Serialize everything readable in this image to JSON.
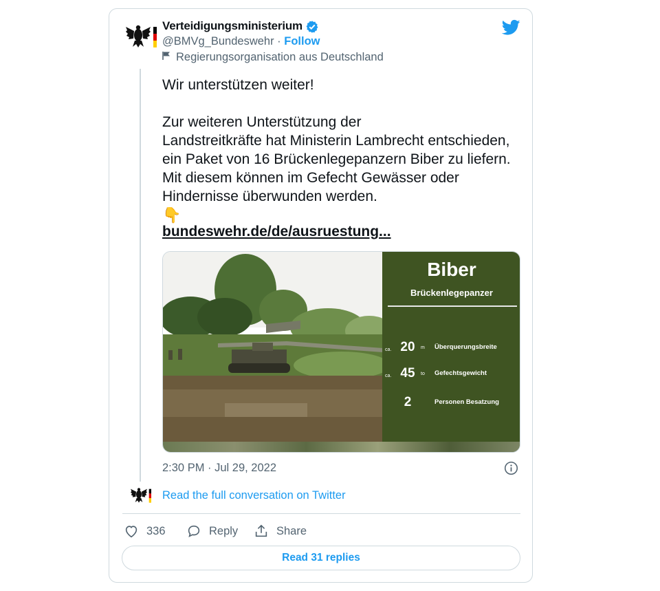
{
  "author": {
    "name": "Verteidigungsministerium",
    "handle": "@BMVg_Bundeswehr",
    "separator": " · ",
    "follow_label": "Follow",
    "org_label": "Regierungsorganisation aus Deutschland",
    "avatar_icon": "federal-eagle-icon",
    "verified_icon": "verified-badge-icon"
  },
  "tweet": {
    "line1": "Wir unterstützen weiter!",
    "para2_a": "Zur weiteren Unterstützung der",
    "para2_b": "Landstreitkräfte hat Ministerin Lambrecht entschieden, ein Paket von 16 Brückenlegepanzern Biber zu liefern. Mit diesem können im Gefecht Gewässer oder Hindernisse überwunden werden.",
    "emoji_flag": "ukraine-flag-icon",
    "emoji_hand": "👇",
    "link_text": "bundeswehr.de/de/ausruestung..."
  },
  "media": {
    "title": "Biber",
    "subtitle": "Brückenlegepanzer",
    "stats": [
      {
        "prefix": "ca.",
        "value": "20",
        "unit": "m",
        "label": "Überquerungsbreite"
      },
      {
        "prefix": "ca.",
        "value": "45",
        "unit": "to",
        "label": "Gefechtsgewicht"
      },
      {
        "prefix": "",
        "value": "2",
        "unit": "",
        "label": "Personen Besatzung"
      }
    ],
    "panel_color": "#3f5422"
  },
  "meta": {
    "timestamp": "2:30 PM · Jul 29, 2022",
    "read_full": "Read the full conversation on Twitter"
  },
  "actions": {
    "like_count": "336",
    "reply_label": "Reply",
    "share_label": "Share",
    "read_replies": "Read 31 replies"
  },
  "colors": {
    "accent": "#1d9bf0",
    "secondary_text": "#536471",
    "border": "#cfd9de"
  }
}
